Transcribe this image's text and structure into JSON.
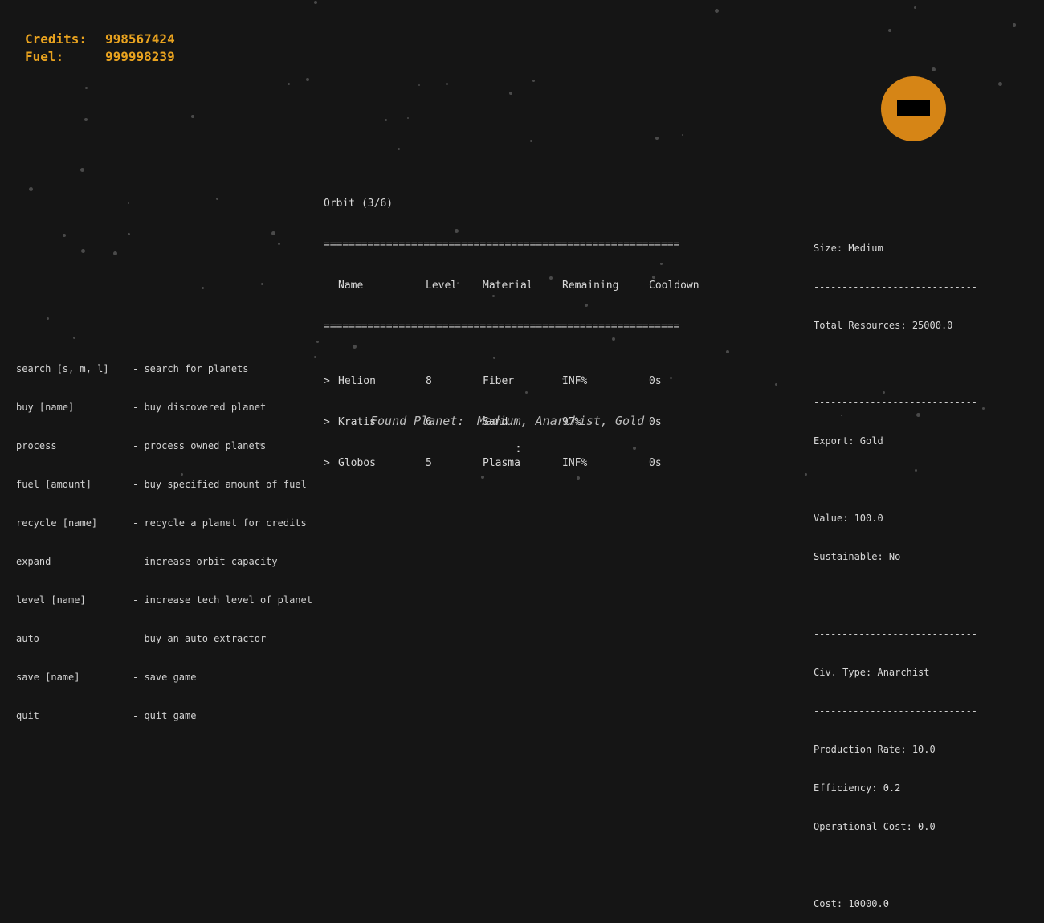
{
  "resources": {
    "credits_label": "Credits:",
    "credits_value": "998567424",
    "fuel_label": "Fuel:",
    "fuel_value": "999998239",
    "color": "#e8a21f"
  },
  "planet_preview": {
    "icon": "planet-icon",
    "color": "#d68516",
    "band_color": "#000000"
  },
  "orbit": {
    "title": "Orbit (3/6)",
    "separator": "=========================================================",
    "headers": [
      "Name",
      "Level",
      "Material",
      "Remaining",
      "Cooldown"
    ],
    "rows": [
      {
        "marker": ">",
        "name": "Helion",
        "level": "8",
        "material": "Fiber",
        "remaining": "INF%",
        "cooldown": "0s"
      },
      {
        "marker": ">",
        "name": "Kratis",
        "level": "6",
        "material": "Sand",
        "remaining": "97%",
        "cooldown": "0s"
      },
      {
        "marker": ">",
        "name": "Globos",
        "level": "5",
        "material": "Plasma",
        "remaining": "INF%",
        "cooldown": "0s"
      }
    ]
  },
  "planet_info": {
    "divider": "-----------------------------",
    "size": "Size: Medium",
    "total_resources": "Total Resources: 25000.0",
    "export": "Export: Gold",
    "value": "Value: 100.0",
    "sustainable": "Sustainable: No",
    "civ_type": "Civ. Type: Anarchist",
    "production_rate": "Production Rate: 10.0",
    "efficiency": "Efficiency: 0.2",
    "operational_cost": "Operational Cost: 0.0",
    "cost": "Cost: 10000.0"
  },
  "commands": [
    {
      "command": "search [s, m, l]",
      "description": "- search for planets"
    },
    {
      "command": "buy [name]",
      "description": "- buy discovered planet"
    },
    {
      "command": "process",
      "description": "- process owned planets"
    },
    {
      "command": "fuel [amount]",
      "description": "- buy specified amount of fuel"
    },
    {
      "command": "recycle [name]",
      "description": "- recycle a planet for credits"
    },
    {
      "command": "expand",
      "description": "- increase orbit capacity"
    },
    {
      "command": "level [name]",
      "description": "- increase tech level of planet"
    },
    {
      "command": "auto",
      "description": "- buy an auto-extractor"
    },
    {
      "command": "save [name]",
      "description": "- save game"
    },
    {
      "command": "quit",
      "description": "- quit game"
    }
  ],
  "found_planet": {
    "label": "Found Planet:",
    "details": "Medium, Anarchist, Gold"
  },
  "prompt": {
    "text": ":"
  }
}
